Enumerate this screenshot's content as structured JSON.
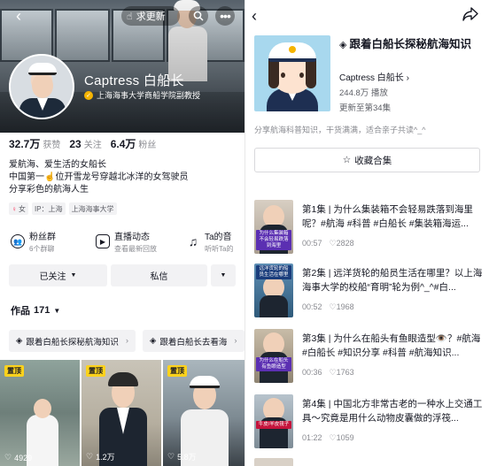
{
  "profile": {
    "update_label": "求更新",
    "name": "Captress 白船长",
    "verification": "上海海事大学商船学院副教授",
    "stats": [
      {
        "num": "32.7万",
        "label": "获赞"
      },
      {
        "num": "23",
        "label": "关注"
      },
      {
        "num": "6.4万",
        "label": "粉丝"
      }
    ],
    "bio": [
      "爱航海、爱生活的女船长",
      "中国第一☝️位开雪龙号穿越北冰洋的女驾驶员",
      "分享彩色的航海人生"
    ],
    "tags": {
      "gender": "女",
      "ip": "IP：上海",
      "school": "上海海事大学"
    },
    "features": [
      {
        "title": "粉丝群",
        "sub": "6个群聊"
      },
      {
        "title": "直播动态",
        "sub": "查看最新回放"
      },
      {
        "title": "Ta的音",
        "sub": "听听Ta的"
      }
    ],
    "buttons": {
      "followed": "已关注",
      "message": "私信"
    },
    "works_label": "作品",
    "works_count": "171",
    "collections": [
      "跟着白船长探秘航海知识",
      "跟着白船长去看海"
    ],
    "videos": [
      {
        "pin": "置顶",
        "likes": "4929"
      },
      {
        "pin": "置顶",
        "likes": "1.2万"
      },
      {
        "pin": "置顶",
        "likes": "5.8万"
      }
    ]
  },
  "collection": {
    "title": "跟着白船长探秘航海知识",
    "author": "Captress 白船长 ›",
    "plays": "244.8万 播放",
    "updated": "更新至第34集",
    "description": "分享航海科普知识，干货满满，适合亲子共读^_^",
    "collect_button": "收藏合集",
    "episodes": [
      {
        "title": "第1集 | 为什么集装箱不会轻易跌落到海里呢？#航海 #科普 #白船长 #集装箱海运...",
        "duration": "00:57",
        "likes": "2828",
        "overlay": "为什么集装箱不会轻易跌落到海里"
      },
      {
        "title": "第2集 | 远洋货轮的船员生活在哪里？以上海海事大学的校船“育明”轮为例^_^#白...",
        "duration": "00:52",
        "likes": "1968",
        "overlay": "远洋货轮的船员生活在哪里"
      },
      {
        "title": "第3集 | 为什么在船头有鱼眼造型👁️？#航海 #白船长 #知识分享 #科普 #航海知识...",
        "duration": "00:36",
        "likes": "1763",
        "overlay": "为什么在船头有鱼眼造型"
      },
      {
        "title": "第4集 | 中国北方非常古老的一种水上交通工具～究竟是用什么动物皮囊做的浮筏...",
        "duration": "01:22",
        "likes": "1059",
        "overlay": "牛皮/羊皮筏子"
      }
    ]
  }
}
